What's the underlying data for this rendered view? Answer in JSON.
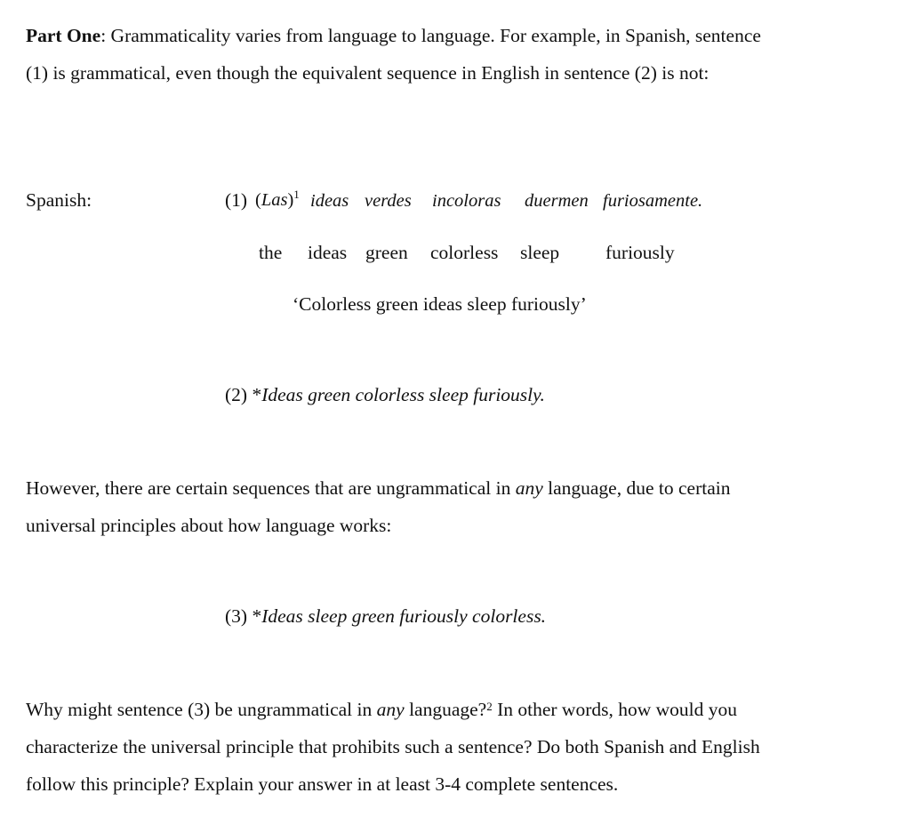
{
  "intro": {
    "heading": "Part One",
    "line1_rest": ": Grammaticality varies from language to language. For example, in Spanish, sentence",
    "line2": "(1) is grammatical, even though the equivalent sequence in English in sentence (2) is not:"
  },
  "example1": {
    "language_label": "Spanish:",
    "number": "(1)",
    "words": [
      "(Las)",
      "ideas",
      "verdes",
      "incoloras",
      "duermen",
      "furiosamente."
    ],
    "footnote_marker": "1",
    "gloss": [
      "the",
      "ideas",
      "green",
      "colorless",
      "sleep",
      "furiously"
    ],
    "translation": "‘Colorless green ideas sleep furiously’"
  },
  "example2": {
    "number": "(2)",
    "star": "*",
    "sentence": "Ideas green colorless sleep furiously."
  },
  "middle_paragraph": {
    "line1_pre": "However, there are certain sequences that are ungrammatical in ",
    "line1_emph": "any",
    "line1_post": " language, due to certain",
    "line2": "universal principles about how language works:"
  },
  "example3": {
    "number": "(3)",
    "star": "*",
    "sentence": "Ideas sleep green furiously colorless."
  },
  "question": {
    "line1_pre": "Why might sentence (3) be ungrammatical in ",
    "line1_emph": "any",
    "line1_mid": " language?",
    "footnote_marker": "2",
    "line1_post": " In other words, how would you",
    "line2": "characterize the universal principle that prohibits such a sentence? Do both Spanish and English",
    "line3": "follow this principle? Explain your answer in at least 3-4 complete sentences."
  }
}
